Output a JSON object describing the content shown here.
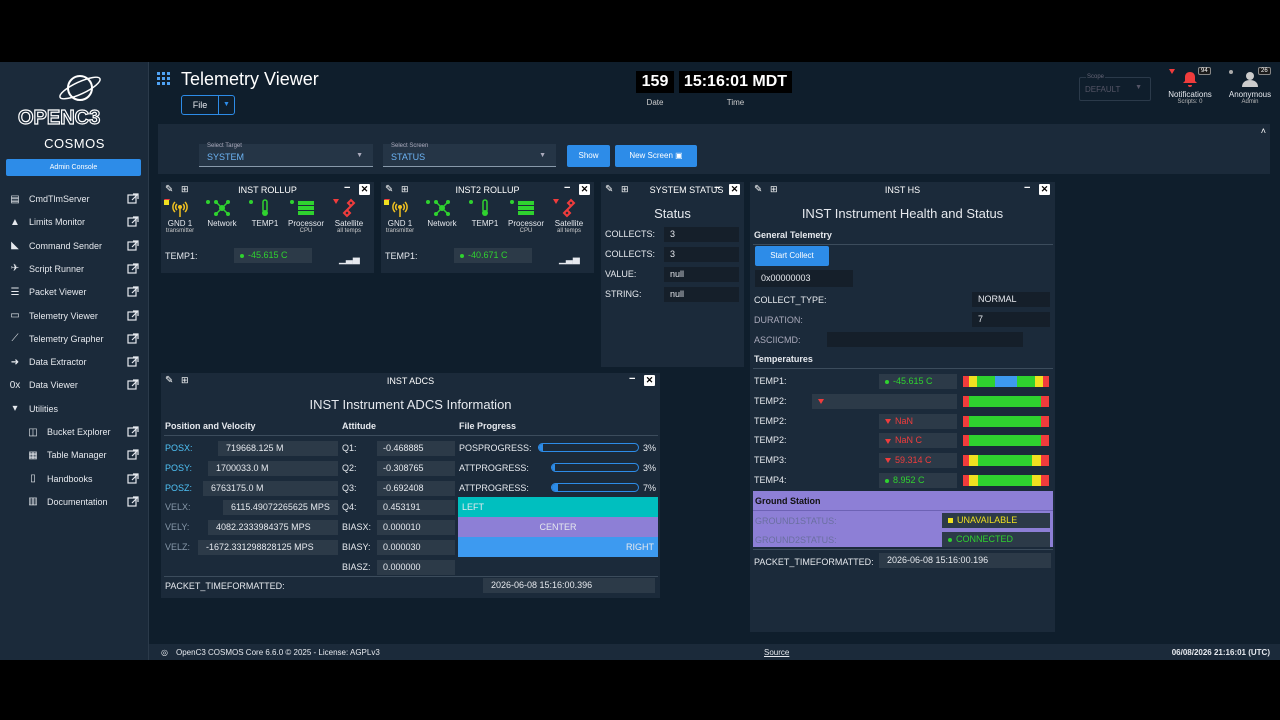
{
  "app": {
    "brand": "COSMOS",
    "admin": "Admin Console",
    "title": "Telemetry Viewer",
    "file": "File"
  },
  "nav": [
    {
      "label": "CmdTlmServer",
      "icon": "server-icon"
    },
    {
      "label": "Limits Monitor",
      "icon": "warning-icon"
    },
    {
      "label": "Command Sender",
      "icon": "satellite-dish-icon"
    },
    {
      "label": "Script Runner",
      "icon": "runner-icon"
    },
    {
      "label": "Packet Viewer",
      "icon": "list-icon"
    },
    {
      "label": "Telemetry Viewer",
      "icon": "monitor-icon"
    },
    {
      "label": "Telemetry Grapher",
      "icon": "chart-icon"
    },
    {
      "label": "Data Extractor",
      "icon": "arrow-out-icon"
    },
    {
      "label": "Data Viewer",
      "icon": "binary-icon"
    },
    {
      "label": "Utilities",
      "icon": "chevron-down-icon"
    },
    {
      "label": "Bucket Explorer",
      "icon": "bucket-icon"
    },
    {
      "label": "Table Manager",
      "icon": "table-icon"
    },
    {
      "label": "Handbooks",
      "icon": "book-icon"
    },
    {
      "label": "Documentation",
      "icon": "library-icon"
    }
  ],
  "clock": {
    "date": "159",
    "time": "15:16:01 MDT",
    "date_label": "Date",
    "time_label": "Time"
  },
  "scope": {
    "label": "Scope",
    "value": "DEFAULT"
  },
  "notifications": {
    "label": "Notifications",
    "sub": "Scripts: 0",
    "count": "94"
  },
  "user": {
    "label": "Anonymous",
    "sub": "Admin",
    "count": "26"
  },
  "selector": {
    "target_label": "Select Target",
    "target": "SYSTEM",
    "screen_label": "Select Screen",
    "screen": "STATUS",
    "show": "Show",
    "new_screen": "New Screen"
  },
  "rollup1": {
    "title": "INST ROLLUP",
    "temp_label": "TEMP1:",
    "temp_value": "-45.615 C"
  },
  "rollup2": {
    "title": "INST2 ROLLUP",
    "temp_label": "TEMP1:",
    "temp_value": "-40.671 C"
  },
  "rollup_icons": [
    {
      "label": "GND 1",
      "sub": "transmitter"
    },
    {
      "label": "Network",
      "sub": ""
    },
    {
      "label": "TEMP1",
      "sub": ""
    },
    {
      "label": "Processor",
      "sub": "CPU"
    },
    {
      "label": "Satellite",
      "sub": "all temps"
    }
  ],
  "sysstatus": {
    "title": "SYSTEM STATUS",
    "heading": "Status",
    "rows": [
      {
        "label": "COLLECTS:",
        "value": "3"
      },
      {
        "label": "COLLECTS:",
        "value": "3"
      },
      {
        "label": "VALUE:",
        "value": "null"
      },
      {
        "label": "STRING:",
        "value": "null"
      }
    ]
  },
  "hs": {
    "title": "INST HS",
    "heading": "INST Instrument Health and Status",
    "general": "General Telemetry",
    "start": "Start Collect",
    "hex": "0x00000003",
    "collect_type_label": "COLLECT_TYPE:",
    "collect_type": "NORMAL",
    "duration_label": "DURATION:",
    "duration": "7",
    "ascii_label": "ASCIICMD:",
    "temps_label": "Temperatures",
    "temps": [
      {
        "label": "TEMP1:",
        "value": "-45.615 C"
      },
      {
        "label": "TEMP2:",
        "value": ""
      },
      {
        "label": "TEMP2:",
        "value": "NaN"
      },
      {
        "label": "TEMP2:",
        "value": "NaN C"
      },
      {
        "label": "TEMP3:",
        "value": "59.314 C"
      },
      {
        "label": "TEMP4:",
        "value": "8.952 C"
      }
    ],
    "ground_label": "Ground Station",
    "g1_label": "GROUND1STATUS:",
    "g1": "UNAVAILABLE",
    "g2_label": "GROUND2STATUS:",
    "g2": "CONNECTED",
    "ptf_label": "PACKET_TIMEFORMATTED:",
    "ptf": "2026-06-08 15:16:00.196"
  },
  "adcs": {
    "title": "INST ADCS",
    "heading": "INST Instrument ADCS Information",
    "pos_label": "Position and Velocity",
    "att_label": "Attitude",
    "fp_label": "File Progress",
    "pv": [
      {
        "label": "POSX:",
        "value": "719668.125 M"
      },
      {
        "label": "POSY:",
        "value": "1700033.0 M"
      },
      {
        "label": "POSZ:",
        "value": "6763175.0 M"
      },
      {
        "label": "VELX:",
        "value": "6115.49072265625 MPS"
      },
      {
        "label": "VELY:",
        "value": "4082.2333984375 MPS"
      },
      {
        "label": "VELZ:",
        "value": "-1672.331298828125 MPS"
      }
    ],
    "att": [
      {
        "label": "Q1:",
        "value": "-0.468885"
      },
      {
        "label": "Q2:",
        "value": "-0.308765"
      },
      {
        "label": "Q3:",
        "value": "-0.692408"
      },
      {
        "label": "Q4:",
        "value": "0.453191"
      },
      {
        "label": "BIASX:",
        "value": "0.000010"
      },
      {
        "label": "BIASY:",
        "value": "0.000030"
      },
      {
        "label": "BIASZ:",
        "value": "0.000000"
      }
    ],
    "fp": [
      {
        "label": "POSPROGRESS:",
        "value": "3%",
        "progress": 0.03
      },
      {
        "label": "ATTPROGRESS:",
        "value": "3%",
        "progress": 0.03
      },
      {
        "label": "ATTPROGRESS:",
        "value": "7%",
        "progress": 0.07
      }
    ],
    "left": "LEFT",
    "center": "CENTER",
    "right": "RIGHT",
    "ptf_label": "PACKET_TIMEFORMATTED:",
    "ptf": "2026-06-08 15:16:00.396"
  },
  "footer": {
    "left": "OpenC3 COSMOS Core 6.6.0 © 2025 - License: AGPLv3",
    "source": "Source",
    "right": "06/08/2026 21:16:01 (UTC)"
  },
  "colors": {
    "accent": "#2d8ce8",
    "green": "#2fd22f",
    "red": "#f03c3c",
    "panel": "#1b2a3a"
  }
}
